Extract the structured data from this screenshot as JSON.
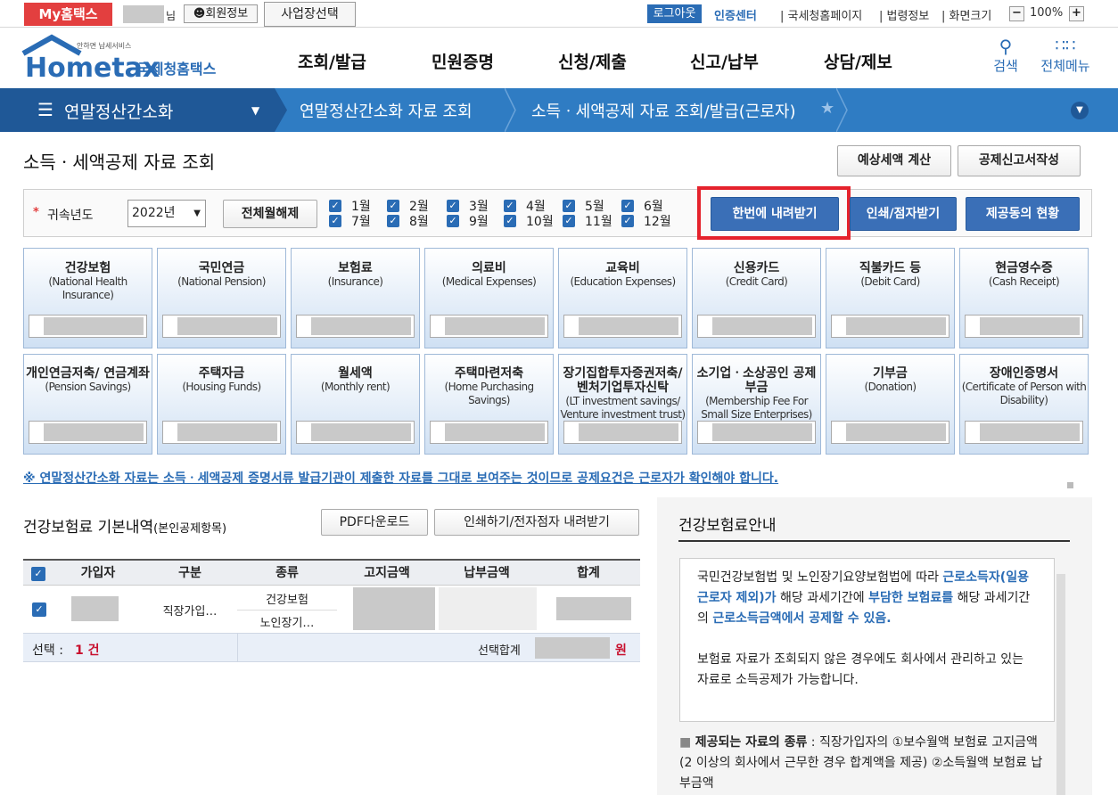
{
  "top": {
    "my_hometax": "My홈택스",
    "nim": "님",
    "member_info": "회원정보",
    "biz_select": "사업장선택",
    "logout": "로그아웃",
    "cert_center": "인증센터",
    "links": [
      "국세청홈페이지",
      "법령정보",
      "화면크기"
    ],
    "zoom": "100%"
  },
  "header": {
    "logo_small": "안하면 납세서비스",
    "logo_main": "Hometax",
    "logo_kr": "국세청홈택스",
    "gnb": [
      "조회/발급",
      "민원증명",
      "신청/제출",
      "신고/납부",
      "상담/제보"
    ],
    "search": "검색",
    "all_menu": "전체메뉴"
  },
  "nav": {
    "menu": "연말정산간소화",
    "crumb1": "연말정산간소화 자료 조회",
    "crumb2": "소득ㆍ세액공제 자료 조회/발급(근로자)"
  },
  "page": {
    "title": "소득ㆍ세액공제 자료 조회",
    "btn_estimate": "예상세액 계산",
    "btn_report": "공제신고서작성"
  },
  "filter": {
    "year_label": "귀속년도",
    "year_value": "2022년",
    "clear_all": "전체월해제",
    "months_row1": [
      "1월",
      "2월",
      "3월",
      "4월",
      "5월",
      "6월"
    ],
    "months_row2": [
      "7월",
      "8월",
      "9월",
      "10월",
      "11월",
      "12월"
    ],
    "download_all": "한번에 내려받기",
    "print": "인쇄/점자받기",
    "consent": "제공동의 현황"
  },
  "tiles_row1": [
    {
      "name": "건강보험",
      "en": "(National Health Insurance)"
    },
    {
      "name": "국민연금",
      "en": "(National Pension)"
    },
    {
      "name": "보험료",
      "en": "(Insurance)"
    },
    {
      "name": "의료비",
      "en": "(Medical Expenses)"
    },
    {
      "name": "교육비",
      "en": "(Education Expenses)"
    },
    {
      "name": "신용카드",
      "en": "(Credit Card)"
    },
    {
      "name": "직불카드 등",
      "en": "(Debit Card)"
    },
    {
      "name": "현금영수증",
      "en": "(Cash Receipt)"
    }
  ],
  "tiles_row2": [
    {
      "name": "개인연금저축/ 연금계좌",
      "en": "(Pension Savings)"
    },
    {
      "name": "주택자금",
      "en": "(Housing Funds)"
    },
    {
      "name": "월세액",
      "en": "(Monthly rent)"
    },
    {
      "name": "주택마련저축",
      "en": "(Home Purchasing Savings)"
    },
    {
      "name": "장기집합투자증권저축/ 벤처기업투자신탁",
      "en": "(LT investment savings/ Venture investment trust)"
    },
    {
      "name": "소기업ㆍ소상공인 공제부금",
      "en": "(Membership Fee For Small Size Enterprises)"
    },
    {
      "name": "기부금",
      "en": "(Donation)"
    },
    {
      "name": "장애인증명서",
      "en": "(Certificate of Person with Disability)"
    }
  ],
  "notice": "※ 연말정산간소화 자료는 소득ㆍ세액공제 증명서류 발급기관이 제출한 자료를 그대로 보여주는 것이므로 공제요건은 근로자가 확인해야 합니다.",
  "section": {
    "title": "건강보험료 기본내역",
    "sub": "(본인공제항목)",
    "pdf": "PDF다운로드",
    "print": "인쇄하기/전자점자 내려받기"
  },
  "table": {
    "headers": [
      "가입자",
      "구분",
      "종류",
      "고지금액",
      "납부금액",
      "합계"
    ],
    "row_type": "직장가입…",
    "kinds": [
      "건강보험",
      "노인장기…"
    ],
    "select_label": "선택 :",
    "select_count": "1 건",
    "sum_label": "선택합계",
    "won": "원"
  },
  "info": {
    "title": "건강보험료안내",
    "p1_a": "국민건강보험법 및 노인장기요양보험법에 따라 ",
    "p1_b": "근로소득자(일용근로자 제외)가",
    "p1_c": " 해당 과세기간에 ",
    "p1_d": "부담한 보험료를",
    "p1_e": " 해당 과세기간의 ",
    "p1_f": "근로소득금액에서 공제할 수 있음.",
    "p2": "보험료 자료가 조회되지 않은 경우에도 회사에서 관리하고 있는 자료로 소득공제가 가능합니다.",
    "bullet_label": "제공되는 자료의 종류",
    "bullet_text": " : 직장가입자의 ①보수월액 보험료 고지금액(2 이상의 회사에서 근무한 경우 합계액을 제공) ②소득월액 보험료 납부금액"
  },
  "colors": {
    "accent": "#2a6cb5",
    "red": "#e33f3f",
    "navy": "#1f5897"
  }
}
